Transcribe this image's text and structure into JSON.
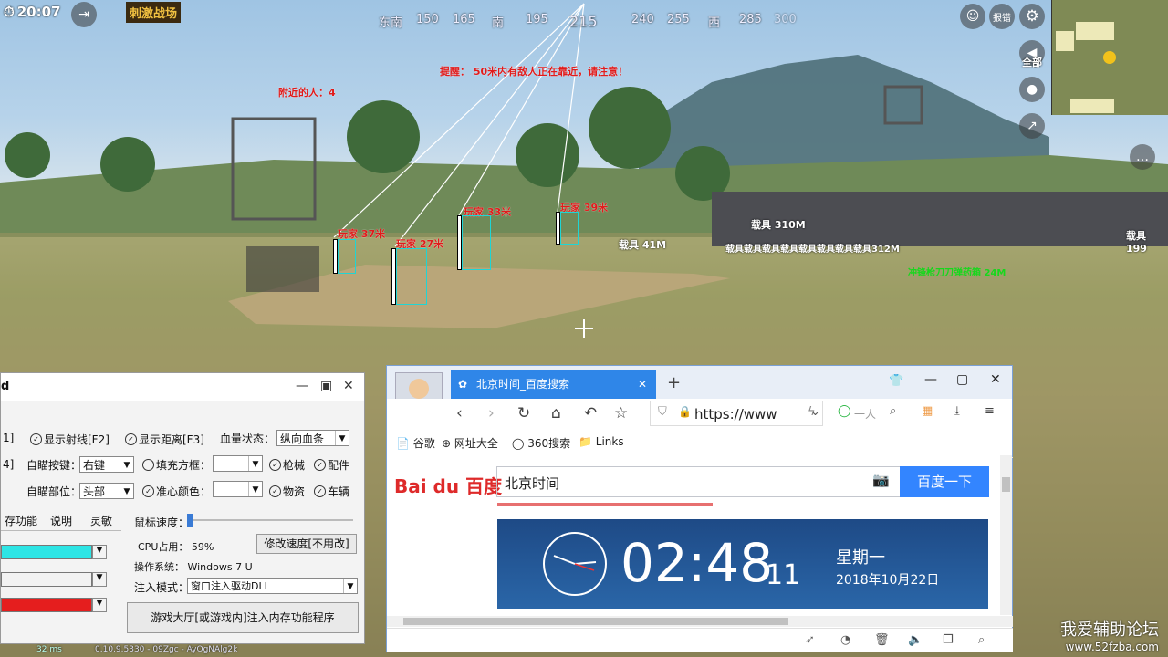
{
  "game": {
    "time": "20:07",
    "logo_text": "刺激战场",
    "compass": [
      "东南",
      "150",
      "165",
      "南",
      "195",
      "215",
      "240",
      "255",
      "西",
      "285",
      "300"
    ],
    "report_label": "报错",
    "volume_label": "全部",
    "warning": "提醒： 50米内有敌人正在靠近，请注意！",
    "nearby": "附近的人：4",
    "players": [
      {
        "label": "玩家 37米"
      },
      {
        "label": "玩家 27米"
      },
      {
        "label": "玩家 33米"
      },
      {
        "label": "玩家 39米"
      }
    ],
    "vehicles": [
      "载具 310M",
      "载具 41M",
      "载具 199"
    ],
    "vehicle_cluster": "载具载具载具载具载具载具载具载具312M",
    "green_label": "冲锋枪刀刀弹药箱 24M"
  },
  "cheat_panel": {
    "title": "d",
    "row1": {
      "c1": "1]",
      "show_ray": "显示射线[F2]",
      "show_dist": "显示距离[F3]",
      "blood_label": "血量状态：",
      "blood_value": "纵向血条"
    },
    "row2": {
      "c1": "4]",
      "aim_key_label": "自瞄按键：",
      "aim_key_value": "右键",
      "fill_box": "填充方框：",
      "gun": "枪械",
      "parts": "配件"
    },
    "row3": {
      "aim_part_label": "自瞄部位：",
      "aim_part_value": "头部",
      "star_color": "准心颜色：",
      "supplies": "物资",
      "vehicle": "车辆"
    },
    "tabs": [
      "存功能",
      "说明",
      "灵敏"
    ],
    "mouse_speed_label": "鼠标速度：",
    "cpu_label": "CPU占用： 59%",
    "os_label": "操作系统： Windows 7  U",
    "inject_label": "注入模式：",
    "inject_value": "窗口注入驱动DLL",
    "modify_btn": "修改速度[不用改]",
    "inject_btn": "游戏大厅[或游戏内]注入内存功能程序",
    "colors": [
      "#2de5e5",
      "#f2f2f2",
      "#e51e1e"
    ]
  },
  "status_bar": {
    "ping": "32 ms",
    "text": "0.10.9.5330 - 09Zgc - AyOgNAlg2k"
  },
  "browser": {
    "tab_title": "北京时间_百度搜索",
    "url": "https://www",
    "search_placeholder": "一人",
    "bookmarks": [
      "谷歌",
      "网址大全",
      "360搜索",
      "Links"
    ],
    "baidu_logo": "Bai du 百度",
    "search_value": "北京时间",
    "search_btn": "百度一下",
    "clock_time": "02:48",
    "clock_seconds": "11",
    "weekday": "星期一",
    "date": "2018年10月22日"
  },
  "watermark": {
    "title": "我爱辅助论坛",
    "url": "www.52fzba.com"
  }
}
